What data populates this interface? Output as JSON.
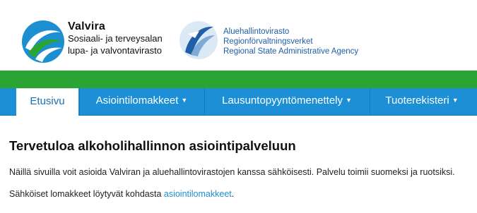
{
  "header": {
    "valvira": {
      "name": "Valvira",
      "line1": "Sosiaali- ja terveysalan",
      "line2": "lupa- ja valvontavirasto"
    },
    "avi": {
      "line1": "Aluehallintovirasto",
      "line2": "Regionförvaltningsverket",
      "line3": "Regional State Administrative Agency"
    }
  },
  "nav": {
    "items": [
      {
        "label": "Etusivu",
        "active": true,
        "caret": ""
      },
      {
        "label": "Asiointilomakkeet",
        "active": false,
        "caret": "▼"
      },
      {
        "label": "Lausuntopyyntömenettely",
        "active": false,
        "caret": "▼"
      },
      {
        "label": "Tuoterekisteri",
        "active": false,
        "caret": "▼"
      }
    ]
  },
  "main": {
    "title": "Tervetuloa alkoholihallinnon asiointipalveluun",
    "paragraph1": "Näillä sivuilla voit asioida Valviran ja aluehallintovirastojen kanssa sähköisesti. Palvelu toimii suomeksi ja ruotsiksi.",
    "paragraph2_prefix": "Sähköiset lomakkeet löytyvät kohdasta ",
    "paragraph2_link": "asiointilomakkeet",
    "paragraph2_suffix": "."
  },
  "colors": {
    "green_bar": "#2aa534",
    "nav_blue": "#1c8fd6",
    "link": "#1c8fd6"
  }
}
